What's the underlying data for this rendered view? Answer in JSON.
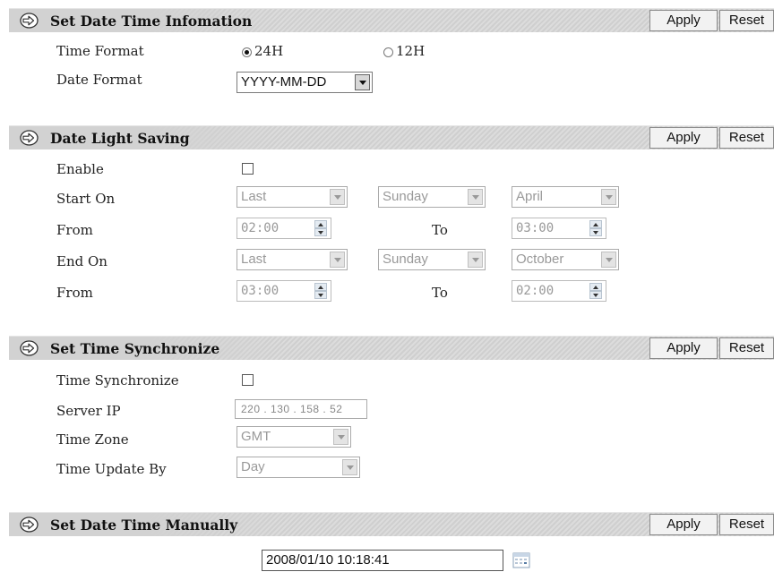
{
  "sections": {
    "date_time_info": {
      "title": "Set Date Time Infomation",
      "apply": "Apply",
      "reset": "Reset",
      "time_format_label": "Time Format",
      "time_format_options": [
        "24H",
        "12H"
      ],
      "time_format_selected": "24H",
      "date_format_label": "Date Format",
      "date_format_value": "YYYY-MM-DD"
    },
    "daylight_saving": {
      "title": "Date Light Saving",
      "apply": "Apply",
      "reset": "Reset",
      "enable_label": "Enable",
      "enable_checked": false,
      "start_on_label": "Start On",
      "start_week": "Last",
      "start_day": "Sunday",
      "start_month": "April",
      "from_label_1": "From",
      "start_from": "02:00",
      "to_label_1": "To",
      "start_to": "03:00",
      "end_on_label": "End On",
      "end_week": "Last",
      "end_day": "Sunday",
      "end_month": "October",
      "from_label_2": "From",
      "end_from": "03:00",
      "to_label_2": "To",
      "end_to": "02:00"
    },
    "time_sync": {
      "title": "Set Time Synchronize",
      "apply": "Apply",
      "reset": "Reset",
      "sync_label": "Time Synchronize",
      "sync_checked": false,
      "server_ip_label": "Server IP",
      "server_ip": "220 . 130 . 158 . 52",
      "time_zone_label": "Time Zone",
      "time_zone": "GMT",
      "update_by_label": "Time Update By",
      "update_by": "Day"
    },
    "manual": {
      "title": "Set Date Time Manually",
      "apply": "Apply",
      "reset": "Reset",
      "datetime": "2008/01/10 10:18:41"
    }
  },
  "icons": {
    "section_arrow": "arrow-right-circle-icon",
    "calendar": "calendar-icon"
  }
}
